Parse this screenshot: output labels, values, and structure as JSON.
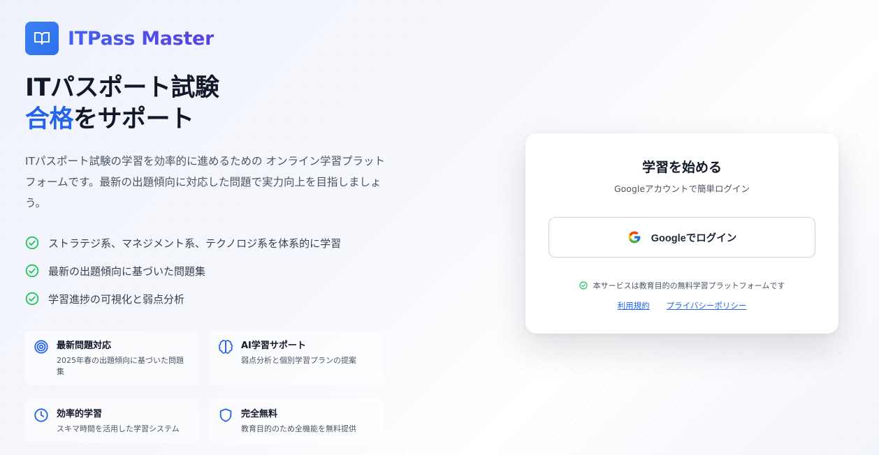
{
  "brand": {
    "name": "ITPass Master",
    "icon": "book-open-icon",
    "color": "#3b82f6"
  },
  "hero": {
    "title_line1": "ITパスポート試験",
    "title_accent": "合格",
    "title_line2_rest": "をサポート",
    "description": "ITパスポート試験の学習を効率的に進めるための オンライン学習プラットフォームです。最新の出題傾向に対応した問題で実力向上を目指しましょう。"
  },
  "checklist": [
    {
      "icon": "check-circle-icon",
      "text": "ストラテジ系、マネジメント系、テクノロジ系を体系的に学習"
    },
    {
      "icon": "check-circle-icon",
      "text": "最新の出題傾向に基づいた問題集"
    },
    {
      "icon": "check-circle-icon",
      "text": "学習進捗の可視化と弱点分析"
    }
  ],
  "features": [
    {
      "icon": "target-icon",
      "title": "最新問題対応",
      "desc": "2025年春の出題傾向に基づいた問題集"
    },
    {
      "icon": "brain-icon",
      "title": "AI学習サポート",
      "desc": "弱点分析と個別学習プランの提案"
    },
    {
      "icon": "clock-icon",
      "title": "効率的学習",
      "desc": "スキマ時間を活用した学習システム"
    },
    {
      "icon": "shield-icon",
      "title": "完全無料",
      "desc": "教育目的のため全機能を無料提供"
    }
  ],
  "login": {
    "title": "学習を始める",
    "subtitle": "Googleアカウントで簡単ログイン",
    "google_button": "Googleでログイン",
    "note": "本サービスは教育目的の無料学習プラットフォームです",
    "links": {
      "terms": "利用規約",
      "privacy": "プライバシーポリシー"
    }
  },
  "colors": {
    "accent": "#2563eb",
    "check": "#22c55e",
    "brand_text": "#4f46e5"
  }
}
